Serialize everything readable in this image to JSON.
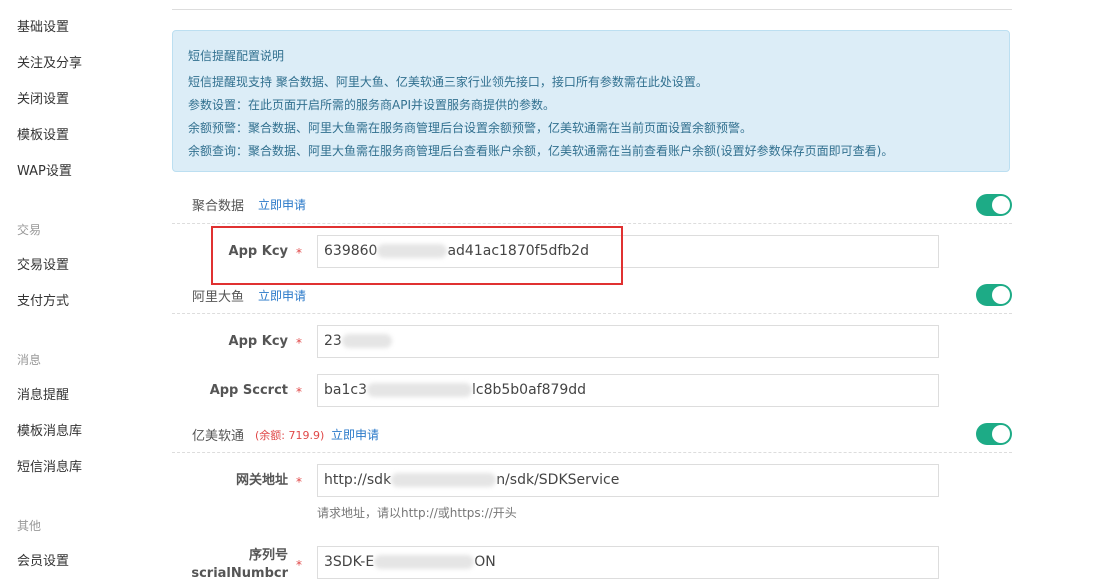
{
  "sidebar": {
    "items1": [
      "基础设置",
      "关注及分享",
      "关闭设置",
      "模板设置",
      "WAP设置"
    ],
    "group_trade": "交易",
    "items2": [
      "交易设置",
      "支付方式"
    ],
    "group_message": "消息",
    "items3": [
      "消息提醒",
      "模板消息库",
      "短信消息库"
    ],
    "group_other": "其他",
    "items4": [
      "会员设置"
    ]
  },
  "info": {
    "title": "短信提醒配置说明",
    "line1": "短信提醒现支持 聚合数据、阿里大鱼、亿美软通三家行业领先接口，接口所有参数需在此处设置。",
    "line2": "参数设置：在此页面开启所需的服务商API并设置服务商提供的参数。",
    "line3": "余额预警：聚合数据、阿里大鱼需在服务商管理后台设置余额预警，亿美软通需在当前页面设置余额预警。",
    "line4": "余额查询：聚合数据、阿里大鱼需在服务商管理后台查看账户余额，亿美软通需在当前查看账户余额(设置好参数保存页面即可查看)。"
  },
  "juhe": {
    "name": "聚合数据",
    "link": "立即申请",
    "appkey_label": "App Kcy",
    "appkey_prefix": "639860",
    "appkey_suffix": "ad41ac1870f5dfb2d"
  },
  "ali": {
    "name": "阿里大鱼",
    "link": "立即申请",
    "appkey_label": "App Kcy",
    "appkey_prefix": "23",
    "secret_label": "App Sccrct",
    "secret_prefix": "ba1c3",
    "secret_suffix": "lc8b5b0af879dd"
  },
  "yimei": {
    "name": "亿美软通",
    "balance": "(余额: 719.9)",
    "link": "立即申请",
    "gateway_label": "网关地址",
    "gateway_prefix": "http://sdk",
    "gateway_suffix": "n/sdk/SDKService",
    "gateway_hint": "请求地址，请以http://或https://开头",
    "serial_label_cn": "序列号",
    "serial_label_en": "scrialNumbcr",
    "serial_prefix": "3SDK-E",
    "serial_suffix": "ON"
  },
  "required_mark": "*",
  "colors": {
    "toggle_on": "#1dab86",
    "link": "#2a79c9",
    "required": "#e04848",
    "highlight": "#e03131",
    "info_bg": "#dcedf7"
  }
}
